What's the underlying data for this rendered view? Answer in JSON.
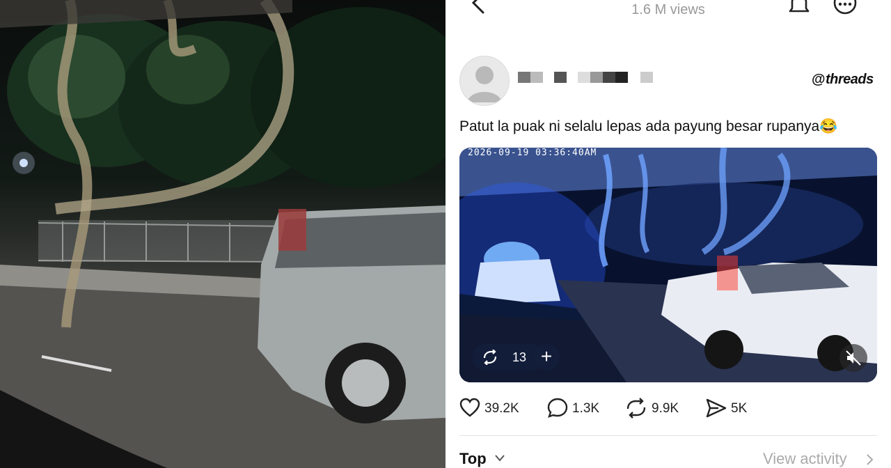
{
  "photo": {
    "description_icon": "dashcam-photo"
  },
  "header": {
    "views": "1.6 M views",
    "back_icon": "chevron-left-icon",
    "bell_icon": "bell-icon",
    "more_icon": "more-icon"
  },
  "post": {
    "username_redacted": true,
    "brand": "threads",
    "brand_glyph": "@",
    "text": "Patut la puak ni selalu lepas ada payung besar rupanya😂",
    "video": {
      "timestamp": "2026-09-19 03:36:40AM",
      "repost_count": "13",
      "add_label": "+"
    },
    "actions": {
      "likes": "39.2K",
      "comments": "1.3K",
      "reposts": "9.9K",
      "shares": "5K"
    }
  },
  "footer": {
    "sort_label": "Top",
    "activity_label": "View activity"
  },
  "colors": {
    "accent_blue": "#1f5bff",
    "text": "#111111",
    "muted": "#999999"
  }
}
